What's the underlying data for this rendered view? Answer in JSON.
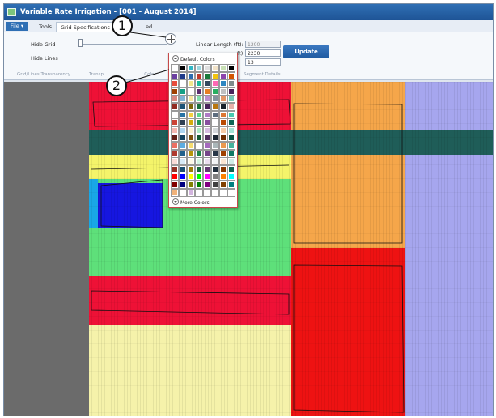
{
  "window": {
    "title": "Variable Rate Irrigation - [001 - August 2014]"
  },
  "tabs": {
    "file": "File",
    "tools": "Tools",
    "grid_spec": "Grid Specifications",
    "hidden_tab": "C",
    "right_hidden_tab": "ed"
  },
  "ribbon": {
    "hide_grid": "Hide Grid",
    "hide_lines": "Hide Lines",
    "group_transparency": "Grid/Lines Transparency",
    "group_transparency_b": "Transp",
    "group_color": "l Color",
    "linear_length_label": "Linear Length (ft):",
    "linear_length_value": "1200",
    "row2_label_suffix": "ft):",
    "row2_value": "2230",
    "row3_value": "13",
    "update": "Update",
    "segment_details": "Segment Details"
  },
  "popup": {
    "header": "Default Colors",
    "footer": "More Colors",
    "swatches": [
      [
        "#ffffff",
        "#000000",
        "#31b8c6",
        "#9fd6df",
        "#e0e0e0",
        "#f2e3c8",
        "#c8e0b4",
        "#000000"
      ],
      [
        "#6b3fa0",
        "#1f3a8a",
        "#2c6cb0",
        "#c0392b",
        "#1b7a3a",
        "#f1c40f",
        "#8e44ad",
        "#d35400"
      ],
      [
        "#e74c3c",
        "#ffffff",
        "#f0e68c",
        "#1abc9c",
        "#34495e",
        "#ff69b4",
        "#2e86c1",
        "#7f8c8d"
      ],
      [
        "#a04000",
        "#16a085",
        "#ffffff",
        "#5b2c6f",
        "#e67e22",
        "#27ae60",
        "#c0c0c0",
        "#4a235a"
      ],
      [
        "#d98880",
        "#7fb3d5",
        "#f9e79f",
        "#82e0aa",
        "#bb8fce",
        "#85929e",
        "#e59866",
        "#73c6b6"
      ],
      [
        "#922b21",
        "#1a5276",
        "#7d6608",
        "#196f3d",
        "#4a235a",
        "#b9770e",
        "#17202a",
        "#e6b0aa"
      ],
      [
        "#ffffff",
        "#2874a6",
        "#f4d03f",
        "#58d68d",
        "#af7ac5",
        "#5d6d7e",
        "#dc7633",
        "#48c9b0"
      ],
      [
        "#cb4335",
        "#2e4053",
        "#d4ac0d",
        "#229954",
        "#884ea0",
        "#ffffff",
        "#ba4a00",
        "#0e6655"
      ],
      [
        "#f5b7b1",
        "#aed6f1",
        "#fcf3cf",
        "#abebc6",
        "#d7bde2",
        "#d5d8dc",
        "#f5cba7",
        "#a3e4d7"
      ],
      [
        "#641e16",
        "#154360",
        "#7e5109",
        "#145a32",
        "#512e5f",
        "#1b2631",
        "#6e2c00",
        "#0b5345"
      ],
      [
        "#ec7063",
        "#5dade2",
        "#f7dc6f",
        "#ffffff",
        "#a569bd",
        "#aab7b8",
        "#eb984e",
        "#45b39d"
      ],
      [
        "#b03a2e",
        "#21618c",
        "#b7950b",
        "#1e8449",
        "#76448a",
        "#283747",
        "#a04000",
        "#117864"
      ],
      [
        "#fadbd8",
        "#d6eaf8",
        "#fef9e7",
        "#d5f5e3",
        "#ebdef0",
        "#f2f3f4",
        "#fae5d3",
        "#d0ece7"
      ],
      [
        "#943126",
        "#1b4f72",
        "#9a7d0a",
        "#186a3b",
        "#633974",
        "#212f3d",
        "#873600",
        "#0e6251"
      ],
      [
        "#ff0000",
        "#0000ff",
        "#ffff00",
        "#00ff00",
        "#ff00ff",
        "#808080",
        "#ff8000",
        "#00ffff"
      ],
      [
        "#800000",
        "#000080",
        "#808000",
        "#008000",
        "#800080",
        "#404040",
        "#804000",
        "#008080"
      ],
      [
        "#f0b27a",
        "#ffffff",
        "#d2b4de",
        "#ffffff",
        "#ffffff",
        "#ffffff",
        "#ffffff",
        "#ffffff"
      ]
    ]
  },
  "callouts": {
    "one": "1",
    "two": "2"
  },
  "colors": {
    "red": "#ee1136",
    "darkgreen": "#1f5d58",
    "yellow": "#f4f46a",
    "green": "#5ee07a",
    "blue": "#1616e0",
    "cyan": "#19a7e6",
    "paleyellow": "#f5f2aa",
    "orange": "#f5a64a",
    "purple": "#a6a6ee",
    "brightred": "#ee1212"
  }
}
